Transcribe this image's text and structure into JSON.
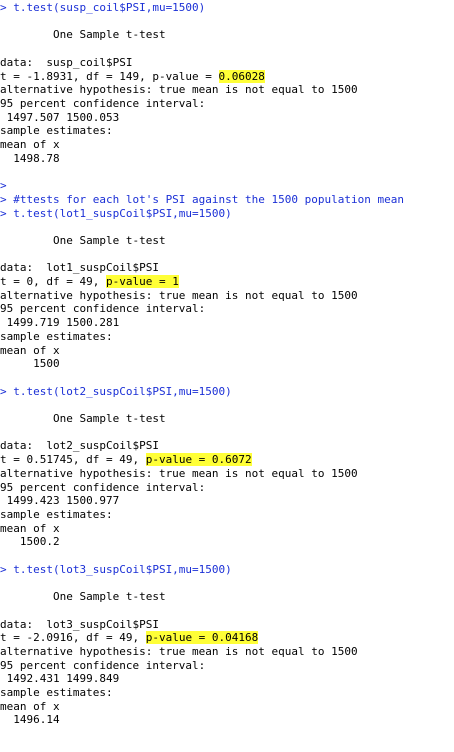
{
  "console": {
    "colors": {
      "prompt_command": "#1a2fd6",
      "output": "#000000",
      "highlight": "#ffff37"
    },
    "lines": [
      {
        "kind": "cmd",
        "text": "> t.test(susp_coil$PSI,mu=1500)"
      },
      {
        "kind": "blank",
        "text": ""
      },
      {
        "kind": "out",
        "text": "        One Sample t-test"
      },
      {
        "kind": "blank",
        "text": ""
      },
      {
        "kind": "out",
        "text": "data:  susp_coil$PSI"
      },
      {
        "kind": "out",
        "text": "t = -1.8931, df = 149, p-value = ",
        "highlight": "0.06028"
      },
      {
        "kind": "out",
        "text": "alternative hypothesis: true mean is not equal to 1500"
      },
      {
        "kind": "out",
        "text": "95 percent confidence interval:"
      },
      {
        "kind": "out",
        "text": " 1497.507 1500.053"
      },
      {
        "kind": "out",
        "text": "sample estimates:"
      },
      {
        "kind": "out",
        "text": "mean of x "
      },
      {
        "kind": "out",
        "text": "  1498.78 "
      },
      {
        "kind": "blank",
        "text": ""
      },
      {
        "kind": "cmd",
        "text": "> "
      },
      {
        "kind": "cmd",
        "text": "> #ttests for each lot's PSI against the 1500 population mean"
      },
      {
        "kind": "cmd",
        "text": "> t.test(lot1_suspCoil$PSI,mu=1500)"
      },
      {
        "kind": "blank",
        "text": ""
      },
      {
        "kind": "out",
        "text": "        One Sample t-test"
      },
      {
        "kind": "blank",
        "text": ""
      },
      {
        "kind": "out",
        "text": "data:  lot1_suspCoil$PSI"
      },
      {
        "kind": "out",
        "text": "t = 0, df = 49, ",
        "highlight": "p-value = 1"
      },
      {
        "kind": "out",
        "text": "alternative hypothesis: true mean is not equal to 1500"
      },
      {
        "kind": "out",
        "text": "95 percent confidence interval:"
      },
      {
        "kind": "out",
        "text": " 1499.719 1500.281"
      },
      {
        "kind": "out",
        "text": "sample estimates:"
      },
      {
        "kind": "out",
        "text": "mean of x "
      },
      {
        "kind": "out",
        "text": "     1500 "
      },
      {
        "kind": "blank",
        "text": ""
      },
      {
        "kind": "cmd",
        "text": "> t.test(lot2_suspCoil$PSI,mu=1500)"
      },
      {
        "kind": "blank",
        "text": ""
      },
      {
        "kind": "out",
        "text": "        One Sample t-test"
      },
      {
        "kind": "blank",
        "text": ""
      },
      {
        "kind": "out",
        "text": "data:  lot2_suspCoil$PSI"
      },
      {
        "kind": "out",
        "text": "t = 0.51745, df = 49, ",
        "highlight": "p-value = 0.6072"
      },
      {
        "kind": "out",
        "text": "alternative hypothesis: true mean is not equal to 1500"
      },
      {
        "kind": "out",
        "text": "95 percent confidence interval:"
      },
      {
        "kind": "out",
        "text": " 1499.423 1500.977"
      },
      {
        "kind": "out",
        "text": "sample estimates:"
      },
      {
        "kind": "out",
        "text": "mean of x "
      },
      {
        "kind": "out",
        "text": "   1500.2 "
      },
      {
        "kind": "blank",
        "text": ""
      },
      {
        "kind": "cmd",
        "text": "> t.test(lot3_suspCoil$PSI,mu=1500)"
      },
      {
        "kind": "blank",
        "text": ""
      },
      {
        "kind": "out",
        "text": "        One Sample t-test"
      },
      {
        "kind": "blank",
        "text": ""
      },
      {
        "kind": "out",
        "text": "data:  lot3_suspCoil$PSI"
      },
      {
        "kind": "out",
        "text": "t = -2.0916, df = 49, ",
        "highlight": "p-value = 0.04168"
      },
      {
        "kind": "out",
        "text": "alternative hypothesis: true mean is not equal to 1500"
      },
      {
        "kind": "out",
        "text": "95 percent confidence interval:"
      },
      {
        "kind": "out",
        "text": " 1492.431 1499.849"
      },
      {
        "kind": "out",
        "text": "sample estimates:"
      },
      {
        "kind": "out",
        "text": "mean of x "
      },
      {
        "kind": "out",
        "text": "  1496.14 "
      }
    ]
  }
}
